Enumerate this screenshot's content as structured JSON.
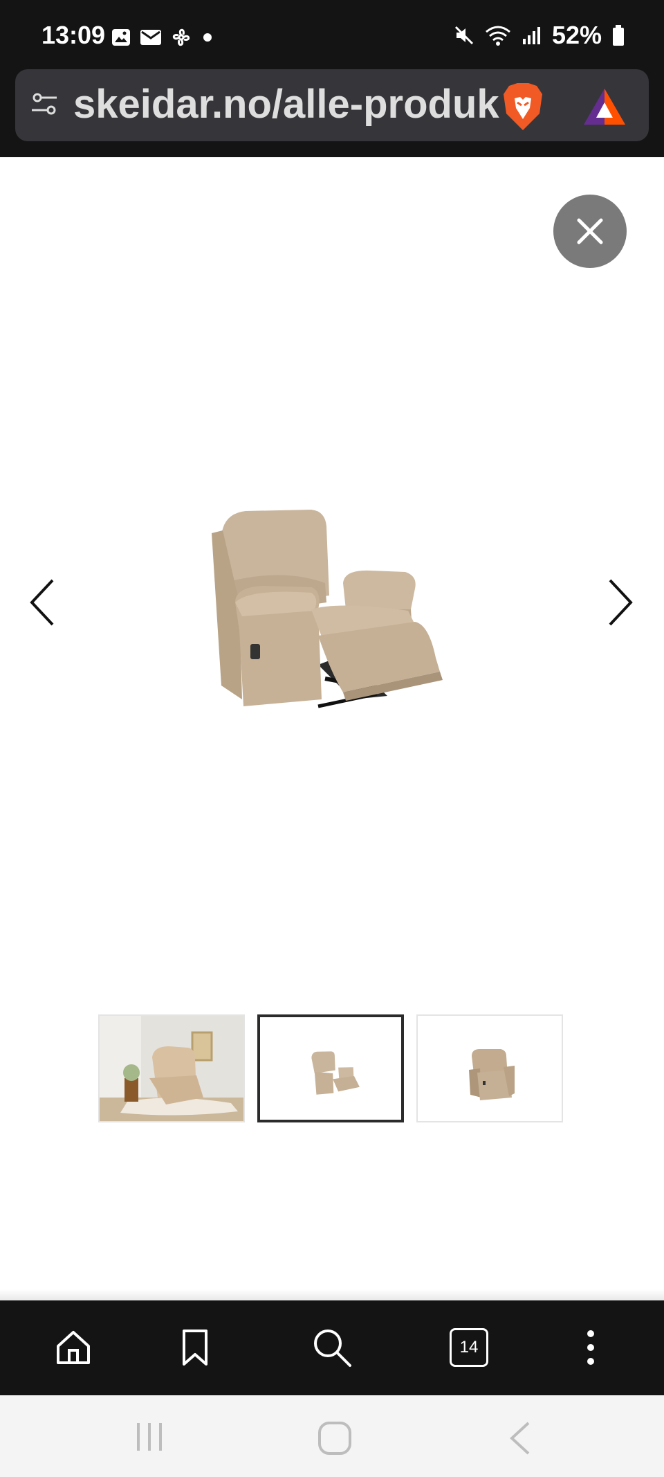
{
  "status_bar": {
    "time": "13:09",
    "battery": "52%",
    "left_icons": [
      "image-icon",
      "mail-icon",
      "fan-icon",
      "dot-icon"
    ],
    "right_icons": [
      "mute-icon",
      "wifi-icon",
      "signal-icon",
      "battery-icon"
    ]
  },
  "browser": {
    "url": "skeidar.no/alle-produkter",
    "tabs_count": "14",
    "toolbar_icons": [
      "home-icon",
      "bookmark-icon",
      "search-icon",
      "tabs-icon",
      "more-icon"
    ]
  },
  "gallery": {
    "thumbnails": [
      {
        "name": "room-photo",
        "selected": false
      },
      {
        "name": "recliner-reclined",
        "selected": true
      },
      {
        "name": "recliner-upright",
        "selected": false
      }
    ]
  },
  "colors": {
    "chrome_dark": "#141414",
    "url_box": "#36363a",
    "close_button": "#7a7a7a",
    "upholstery": "#c9b59c"
  },
  "system_nav": [
    "recents-icon",
    "home-circle-icon",
    "back-icon"
  ]
}
